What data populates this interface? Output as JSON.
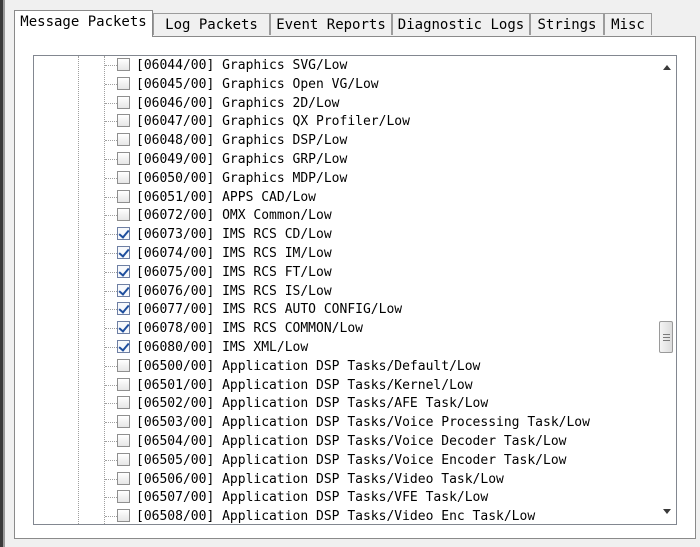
{
  "tabs": [
    {
      "label": "Message Packets",
      "active": true
    },
    {
      "label": "Log Packets",
      "active": false
    },
    {
      "label": "Event Reports",
      "active": false
    },
    {
      "label": "Diagnostic Logs",
      "active": false
    },
    {
      "label": "Strings",
      "active": false
    },
    {
      "label": "Misc",
      "active": false
    }
  ],
  "items": [
    {
      "label": "[06044/00] Graphics SVG/Low",
      "checked": false
    },
    {
      "label": "[06045/00] Graphics Open VG/Low",
      "checked": false
    },
    {
      "label": "[06046/00] Graphics 2D/Low",
      "checked": false
    },
    {
      "label": "[06047/00] Graphics QX Profiler/Low",
      "checked": false
    },
    {
      "label": "[06048/00] Graphics DSP/Low",
      "checked": false
    },
    {
      "label": "[06049/00] Graphics GRP/Low",
      "checked": false
    },
    {
      "label": "[06050/00] Graphics MDP/Low",
      "checked": false
    },
    {
      "label": "[06051/00] APPS CAD/Low",
      "checked": false
    },
    {
      "label": "[06072/00] OMX Common/Low",
      "checked": false
    },
    {
      "label": "[06073/00] IMS RCS CD/Low",
      "checked": true
    },
    {
      "label": "[06074/00] IMS RCS IM/Low",
      "checked": true
    },
    {
      "label": "[06075/00] IMS RCS FT/Low",
      "checked": true
    },
    {
      "label": "[06076/00] IMS RCS IS/Low",
      "checked": true
    },
    {
      "label": "[06077/00] IMS RCS AUTO CONFIG/Low",
      "checked": true
    },
    {
      "label": "[06078/00] IMS RCS COMMON/Low",
      "checked": true
    },
    {
      "label": "[06080/00] IMS XML/Low",
      "checked": true
    },
    {
      "label": "[06500/00] Application DSP Tasks/Default/Low",
      "checked": false
    },
    {
      "label": "[06501/00] Application DSP Tasks/Kernel/Low",
      "checked": false
    },
    {
      "label": "[06502/00] Application DSP Tasks/AFE Task/Low",
      "checked": false
    },
    {
      "label": "[06503/00] Application DSP Tasks/Voice Processing Task/Low",
      "checked": false
    },
    {
      "label": "[06504/00] Application DSP Tasks/Voice Decoder Task/Low",
      "checked": false
    },
    {
      "label": "[06505/00] Application DSP Tasks/Voice Encoder Task/Low",
      "checked": false
    },
    {
      "label": "[06506/00] Application DSP Tasks/Video Task/Low",
      "checked": false
    },
    {
      "label": "[06507/00] Application DSP Tasks/VFE Task/Low",
      "checked": false
    },
    {
      "label": "[06508/00] Application DSP Tasks/Video Enc Task/Low",
      "checked": false
    }
  ]
}
